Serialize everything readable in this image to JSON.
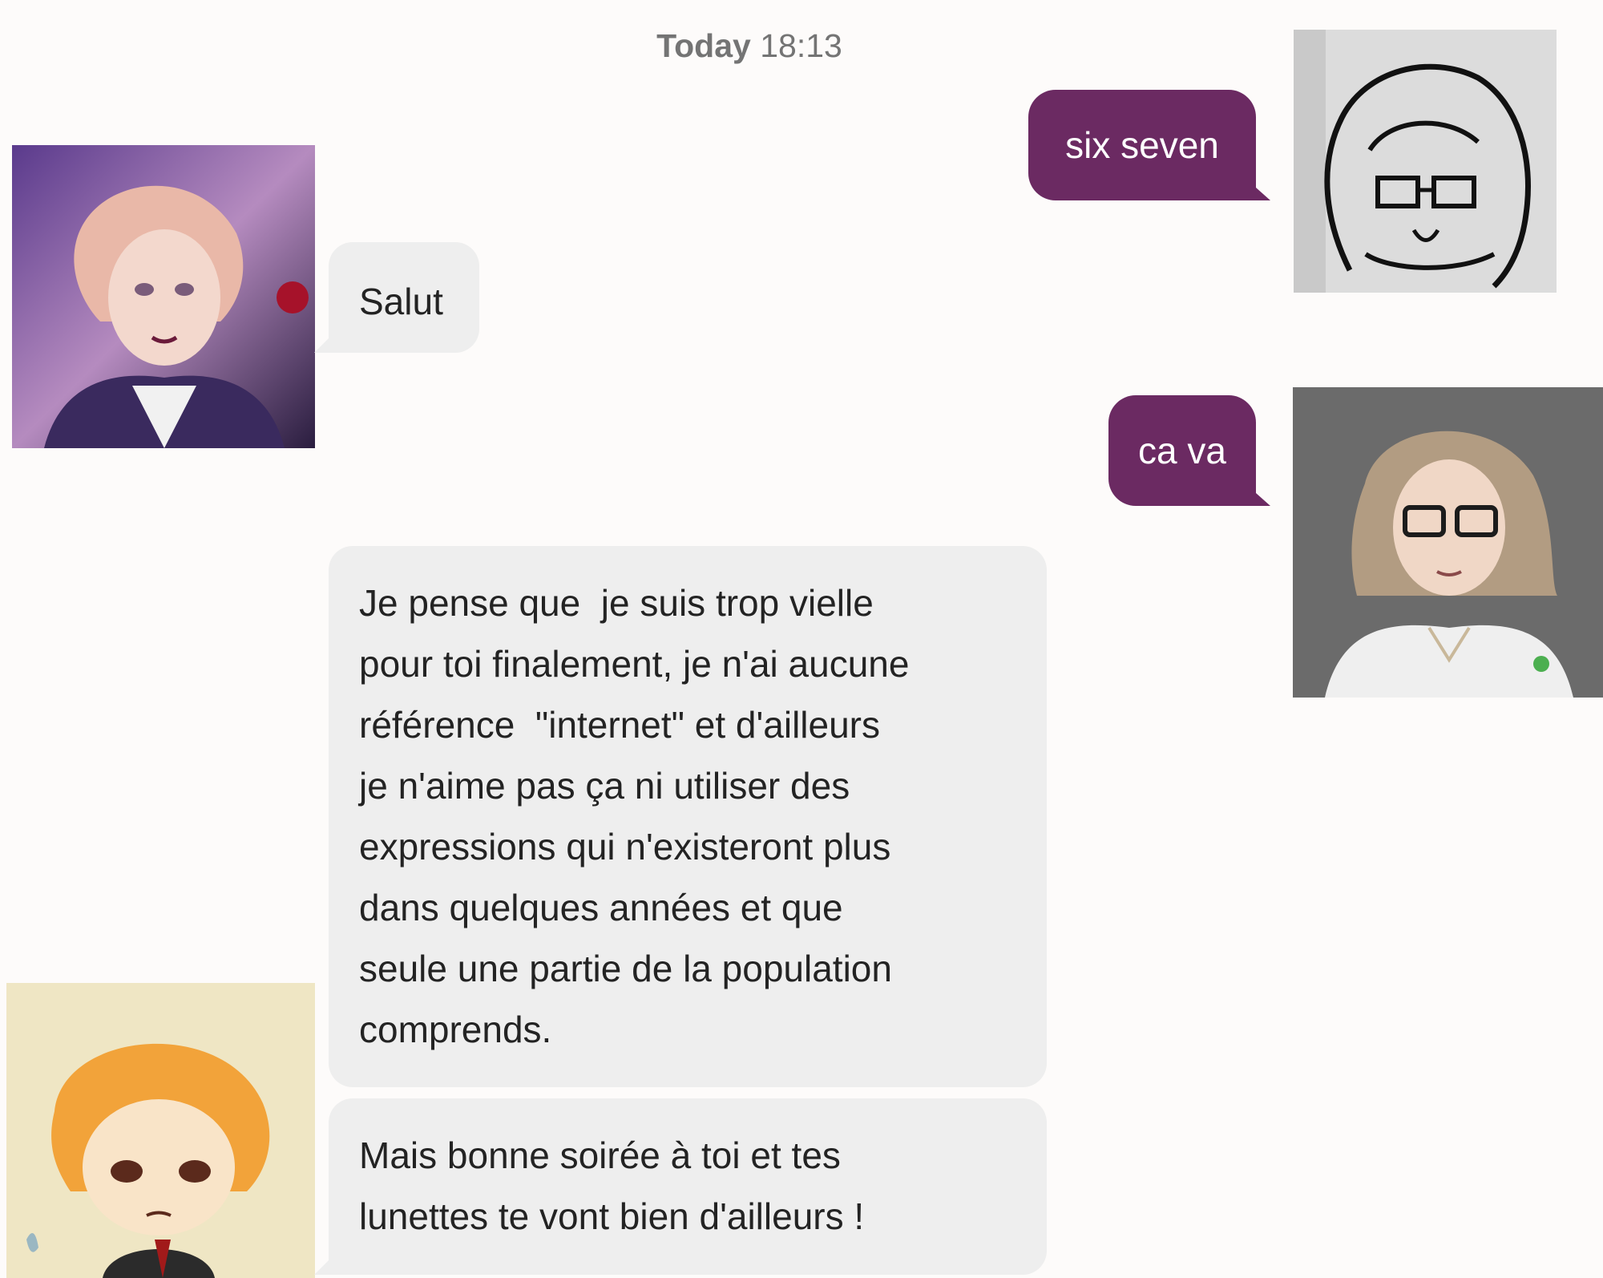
{
  "header": {
    "day": "Today",
    "time": "18:13"
  },
  "messages": [
    {
      "sender": "me",
      "text": "six seven",
      "avatar": "sketch-avatar"
    },
    {
      "sender": "other",
      "text": "Salut",
      "avatar": "anime-avatar-purple"
    },
    {
      "sender": "me",
      "text": "ca va",
      "avatar": "drawn-avatar-glasses"
    },
    {
      "sender": "other",
      "text": "Je pense que  je suis trop vielle\npour toi finalement, je n'ai aucune\nréférence  \"internet\" et d'ailleurs\nje n'aime pas ça ni utiliser des\nexpressions qui n'existeront plus\ndans quelques années et que\nseule une partie de la population\ncomprends."
    },
    {
      "sender": "other",
      "text": "Mais bonne soirée à toi et tes\nlunettes te vont bien d'ailleurs !",
      "avatar": "chibi-avatar-orange"
    }
  ],
  "colors": {
    "outgoing_bubble": "#6b2a62",
    "incoming_bubble": "#eeeeee",
    "background": "#fdfbfa",
    "timestamp_text": "#747474"
  }
}
